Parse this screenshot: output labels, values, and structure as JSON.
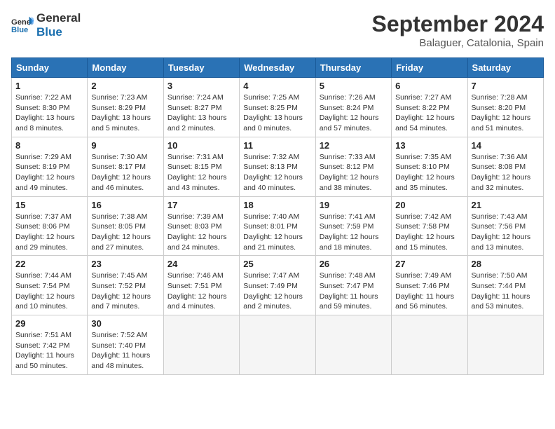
{
  "logo": {
    "text_general": "General",
    "text_blue": "Blue"
  },
  "title": "September 2024",
  "location": "Balaguer, Catalonia, Spain",
  "days_of_week": [
    "Sunday",
    "Monday",
    "Tuesday",
    "Wednesday",
    "Thursday",
    "Friday",
    "Saturday"
  ],
  "weeks": [
    [
      {
        "day": "1",
        "sunrise": "7:22 AM",
        "sunset": "8:30 PM",
        "daylight": "13 hours and 8 minutes."
      },
      {
        "day": "2",
        "sunrise": "7:23 AM",
        "sunset": "8:29 PM",
        "daylight": "13 hours and 5 minutes."
      },
      {
        "day": "3",
        "sunrise": "7:24 AM",
        "sunset": "8:27 PM",
        "daylight": "13 hours and 2 minutes."
      },
      {
        "day": "4",
        "sunrise": "7:25 AM",
        "sunset": "8:25 PM",
        "daylight": "13 hours and 0 minutes."
      },
      {
        "day": "5",
        "sunrise": "7:26 AM",
        "sunset": "8:24 PM",
        "daylight": "12 hours and 57 minutes."
      },
      {
        "day": "6",
        "sunrise": "7:27 AM",
        "sunset": "8:22 PM",
        "daylight": "12 hours and 54 minutes."
      },
      {
        "day": "7",
        "sunrise": "7:28 AM",
        "sunset": "8:20 PM",
        "daylight": "12 hours and 51 minutes."
      }
    ],
    [
      {
        "day": "8",
        "sunrise": "7:29 AM",
        "sunset": "8:19 PM",
        "daylight": "12 hours and 49 minutes."
      },
      {
        "day": "9",
        "sunrise": "7:30 AM",
        "sunset": "8:17 PM",
        "daylight": "12 hours and 46 minutes."
      },
      {
        "day": "10",
        "sunrise": "7:31 AM",
        "sunset": "8:15 PM",
        "daylight": "12 hours and 43 minutes."
      },
      {
        "day": "11",
        "sunrise": "7:32 AM",
        "sunset": "8:13 PM",
        "daylight": "12 hours and 40 minutes."
      },
      {
        "day": "12",
        "sunrise": "7:33 AM",
        "sunset": "8:12 PM",
        "daylight": "12 hours and 38 minutes."
      },
      {
        "day": "13",
        "sunrise": "7:35 AM",
        "sunset": "8:10 PM",
        "daylight": "12 hours and 35 minutes."
      },
      {
        "day": "14",
        "sunrise": "7:36 AM",
        "sunset": "8:08 PM",
        "daylight": "12 hours and 32 minutes."
      }
    ],
    [
      {
        "day": "15",
        "sunrise": "7:37 AM",
        "sunset": "8:06 PM",
        "daylight": "12 hours and 29 minutes."
      },
      {
        "day": "16",
        "sunrise": "7:38 AM",
        "sunset": "8:05 PM",
        "daylight": "12 hours and 27 minutes."
      },
      {
        "day": "17",
        "sunrise": "7:39 AM",
        "sunset": "8:03 PM",
        "daylight": "12 hours and 24 minutes."
      },
      {
        "day": "18",
        "sunrise": "7:40 AM",
        "sunset": "8:01 PM",
        "daylight": "12 hours and 21 minutes."
      },
      {
        "day": "19",
        "sunrise": "7:41 AM",
        "sunset": "7:59 PM",
        "daylight": "12 hours and 18 minutes."
      },
      {
        "day": "20",
        "sunrise": "7:42 AM",
        "sunset": "7:58 PM",
        "daylight": "12 hours and 15 minutes."
      },
      {
        "day": "21",
        "sunrise": "7:43 AM",
        "sunset": "7:56 PM",
        "daylight": "12 hours and 13 minutes."
      }
    ],
    [
      {
        "day": "22",
        "sunrise": "7:44 AM",
        "sunset": "7:54 PM",
        "daylight": "12 hours and 10 minutes."
      },
      {
        "day": "23",
        "sunrise": "7:45 AM",
        "sunset": "7:52 PM",
        "daylight": "12 hours and 7 minutes."
      },
      {
        "day": "24",
        "sunrise": "7:46 AM",
        "sunset": "7:51 PM",
        "daylight": "12 hours and 4 minutes."
      },
      {
        "day": "25",
        "sunrise": "7:47 AM",
        "sunset": "7:49 PM",
        "daylight": "12 hours and 2 minutes."
      },
      {
        "day": "26",
        "sunrise": "7:48 AM",
        "sunset": "7:47 PM",
        "daylight": "11 hours and 59 minutes."
      },
      {
        "day": "27",
        "sunrise": "7:49 AM",
        "sunset": "7:46 PM",
        "daylight": "11 hours and 56 minutes."
      },
      {
        "day": "28",
        "sunrise": "7:50 AM",
        "sunset": "7:44 PM",
        "daylight": "11 hours and 53 minutes."
      }
    ],
    [
      {
        "day": "29",
        "sunrise": "7:51 AM",
        "sunset": "7:42 PM",
        "daylight": "11 hours and 50 minutes."
      },
      {
        "day": "30",
        "sunrise": "7:52 AM",
        "sunset": "7:40 PM",
        "daylight": "11 hours and 48 minutes."
      },
      null,
      null,
      null,
      null,
      null
    ]
  ]
}
